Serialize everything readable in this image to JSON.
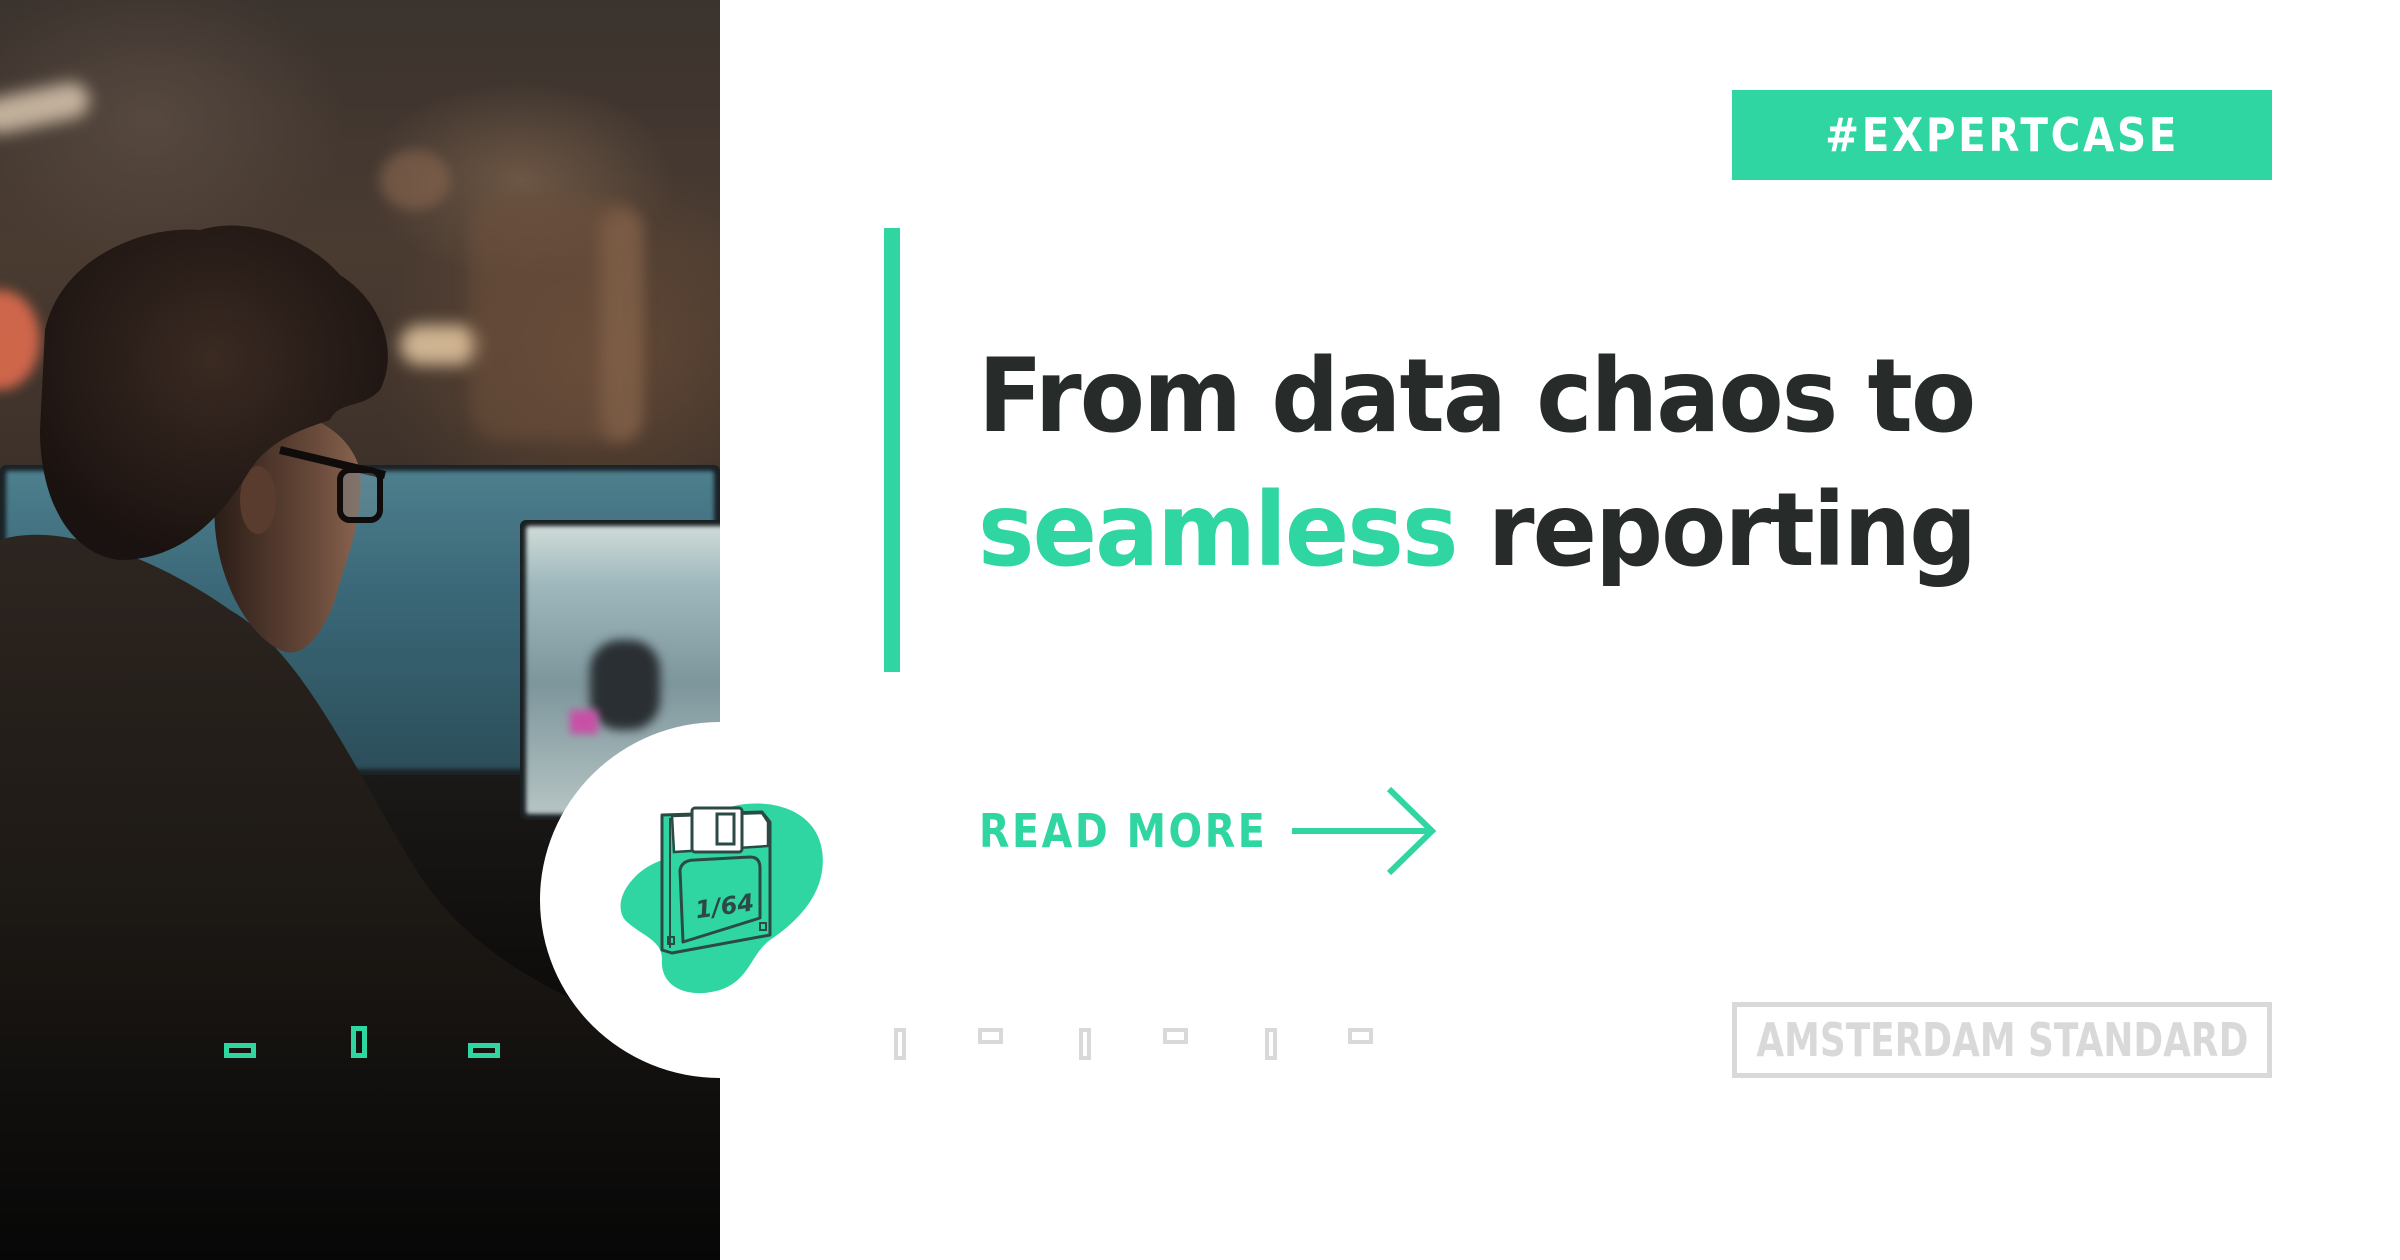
{
  "colors": {
    "accent": "#2fd6a2",
    "headline": "#272c2b",
    "muted": "#d9d9d9",
    "illustration_stroke": "#2b4a45"
  },
  "photo": {
    "description": "Man with glasses working at computer monitors in a dim office"
  },
  "tag": {
    "label": "#EXPERTCASE"
  },
  "headline": {
    "line1": "From data chaos to",
    "line2_highlight": "seamless",
    "line2_rest": " reporting"
  },
  "cta": {
    "label": "READ MORE",
    "icon": "arrow-right-icon"
  },
  "illustration": {
    "floppy_label": "1/64",
    "icon": "floppy-disk-icon"
  },
  "logo": {
    "text": "AMSTERDAM STANDARD"
  }
}
